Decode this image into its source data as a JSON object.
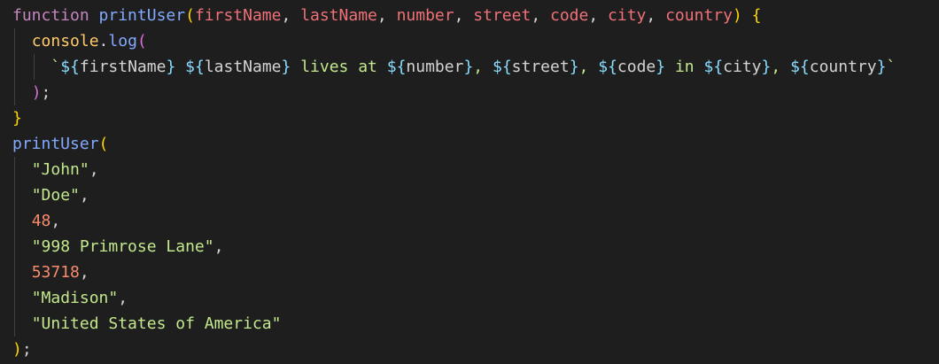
{
  "code": {
    "kw_function": "function",
    "fn_name": "printUser",
    "params": [
      "firstName",
      "lastName",
      "number",
      "street",
      "code",
      "city",
      "country"
    ],
    "console": "console",
    "log": "log",
    "template": {
      "vars": [
        "firstName",
        "lastName",
        "number",
        "street",
        "code",
        "city",
        "country"
      ],
      "text_lives_at": " lives at ",
      "text_in": " in "
    },
    "call_name": "printUser",
    "args": [
      "\"John\"",
      "\"Doe\"",
      "48",
      "\"998 Primrose Lane\"",
      "53718",
      "\"Madison\"",
      "\"United States of America\""
    ]
  },
  "theme": {
    "background": "#1e1e1e",
    "keyword": "#c586c0",
    "function": "#82aaff",
    "parameter": "#f07178",
    "string": "#c3e88d",
    "number": "#f78c6c",
    "bracket_gold": "#ffd700"
  }
}
